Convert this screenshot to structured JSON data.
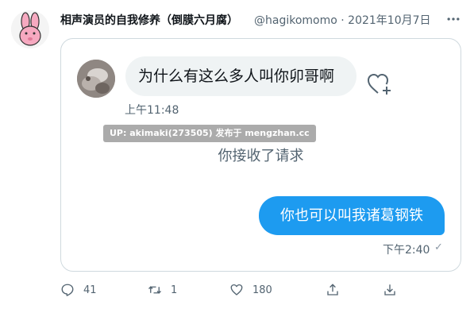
{
  "tweet": {
    "display_name": "相声演员的自我修养（倒膜六月腐）",
    "handle": "@hagikomomo",
    "separator": "·",
    "date": "2021年10月7日"
  },
  "chat": {
    "incoming_message": "为什么有这么多人叫你卯哥啊",
    "incoming_time": "上午11:48",
    "watermark": "UP: akimaki(273505) 发布于 mengzhan.cc",
    "system_message": "你接收了请求",
    "outgoing_message": "你也可以叫我诸葛钢铁",
    "outgoing_time": "下午2:40",
    "read_check": "✓"
  },
  "actions": {
    "replies": "41",
    "retweets": "1",
    "likes": "180"
  },
  "colors": {
    "accent": "#1d9bf0",
    "bubble_gray": "#eff3f4",
    "secondary_text": "#536471",
    "border": "#cfd9de"
  }
}
